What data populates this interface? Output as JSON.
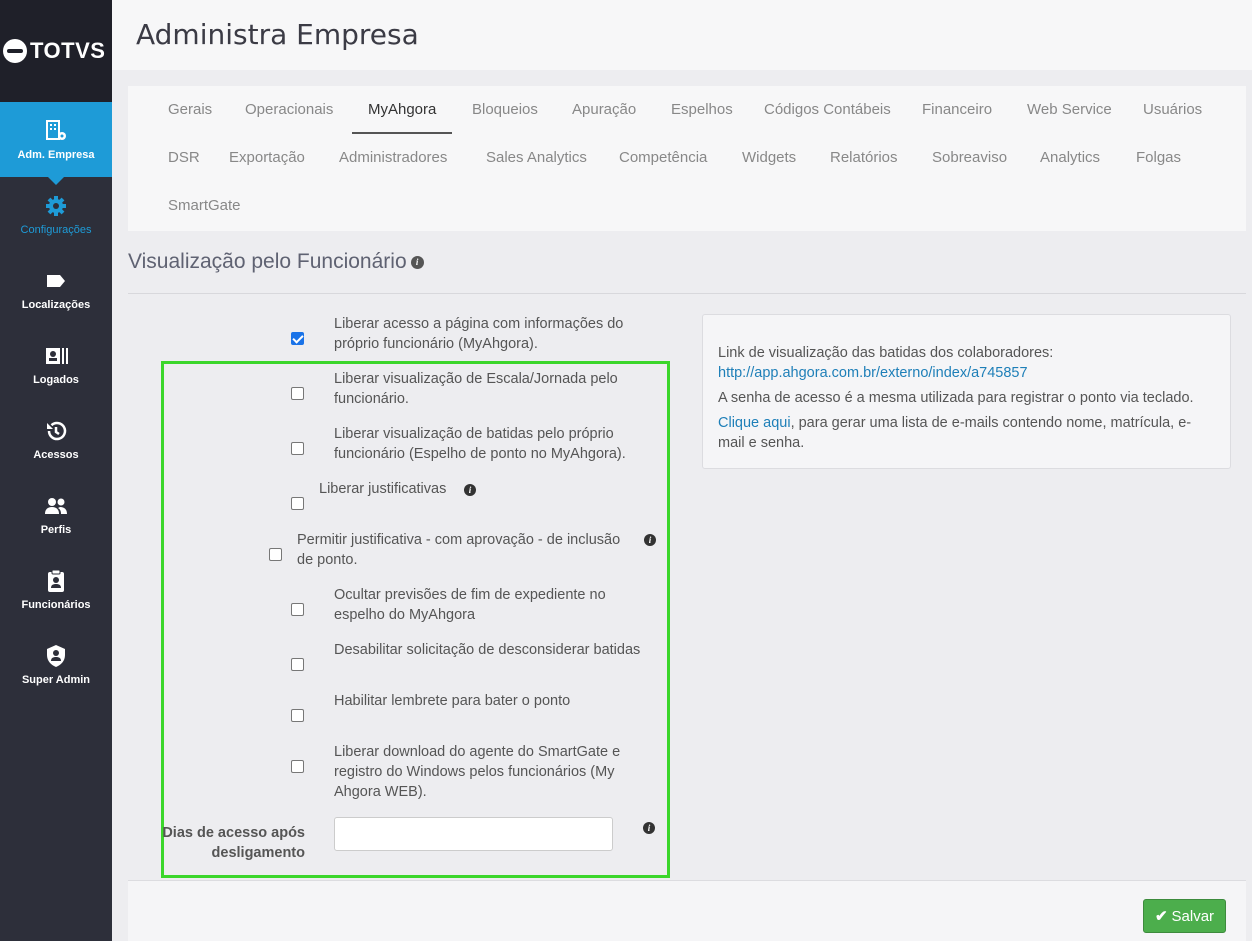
{
  "brand": {
    "logo_text": "TOTVS"
  },
  "sidebar": {
    "items": [
      {
        "label": "Adm. Empresa",
        "icon": "building-gear-icon"
      },
      {
        "label": "Configurações",
        "icon": "gear-icon"
      },
      {
        "label": "Localizações",
        "icon": "tag-icon"
      },
      {
        "label": "Logados",
        "icon": "id-card-icon"
      },
      {
        "label": "Acessos",
        "icon": "history-icon"
      },
      {
        "label": "Perfis",
        "icon": "users-icon"
      },
      {
        "label": "Funcionários",
        "icon": "clipboard-user-icon"
      },
      {
        "label": "Super Admin",
        "icon": "shield-user-icon"
      }
    ]
  },
  "header": {
    "title": "Administra Empresa"
  },
  "tabs": [
    "Gerais",
    "Operacionais",
    "MyAhgora",
    "Bloqueios",
    "Apuração",
    "Espelhos",
    "Códigos Contábeis",
    "Financeiro",
    "Web Service",
    "Usuários",
    "DSR",
    "Exportação",
    "Administradores",
    "Sales Analytics",
    "Competência",
    "Widgets",
    "Relatórios",
    "Sobreaviso",
    "Analytics",
    "Folgas",
    "SmartGate"
  ],
  "selected_tab": "MyAhgora",
  "section": {
    "title": "Visualização pelo Funcionário"
  },
  "options": [
    {
      "line1": "Liberar acesso a página com informações do",
      "line2": "próprio funcionário (MyAhgora).",
      "checked": true
    },
    {
      "line1": "Liberar visualização de Escala/Jornada pelo",
      "line2": "funcionário.",
      "checked": false
    },
    {
      "line1": "Liberar visualização de batidas pelo próprio",
      "line2": "funcionário (Espelho de ponto no MyAhgora).",
      "checked": false
    },
    {
      "line1": "Liberar justificativas",
      "checked": false
    },
    {
      "line1": "Permitir justificativa - com aprovação - de inclusão",
      "line2": "de ponto.",
      "checked": false
    },
    {
      "line1": "Ocultar previsões de fim de expediente no",
      "line2": "espelho do MyAhgora",
      "checked": false
    },
    {
      "line1": "Desabilitar solicitação de desconsiderar batidas",
      "checked": false
    },
    {
      "line1": "Habilitar lembrete para bater o ponto",
      "checked": false
    },
    {
      "line1": "Liberar download do agente do SmartGate e",
      "line2": "registro do Windows pelos funcionários (My",
      "line3": "Ahgora WEB).",
      "checked": false
    }
  ],
  "access_days": {
    "label_line1": "Dias de acesso após",
    "label_line2": "desligamento",
    "value": ""
  },
  "info_box": {
    "line1": "Link de visualização das batidas dos colaboradores:",
    "link": "http://app.ahgora.com.br/externo/index/a745857",
    "line2": "A senha de acesso é a mesma utilizada para registrar o ponto via teclado.",
    "link2": "Clique aqui",
    "line3a": ", para gerar uma lista de e-mails contendo nome, matrícula, e-",
    "line3b": "mail e senha."
  },
  "footer": {
    "save_label": "Salvar"
  },
  "colors": {
    "accent": "#1e9bd7",
    "sidebar": "#2d2f3a",
    "save": "#4cae4c",
    "highlight": "#3bd62b"
  }
}
